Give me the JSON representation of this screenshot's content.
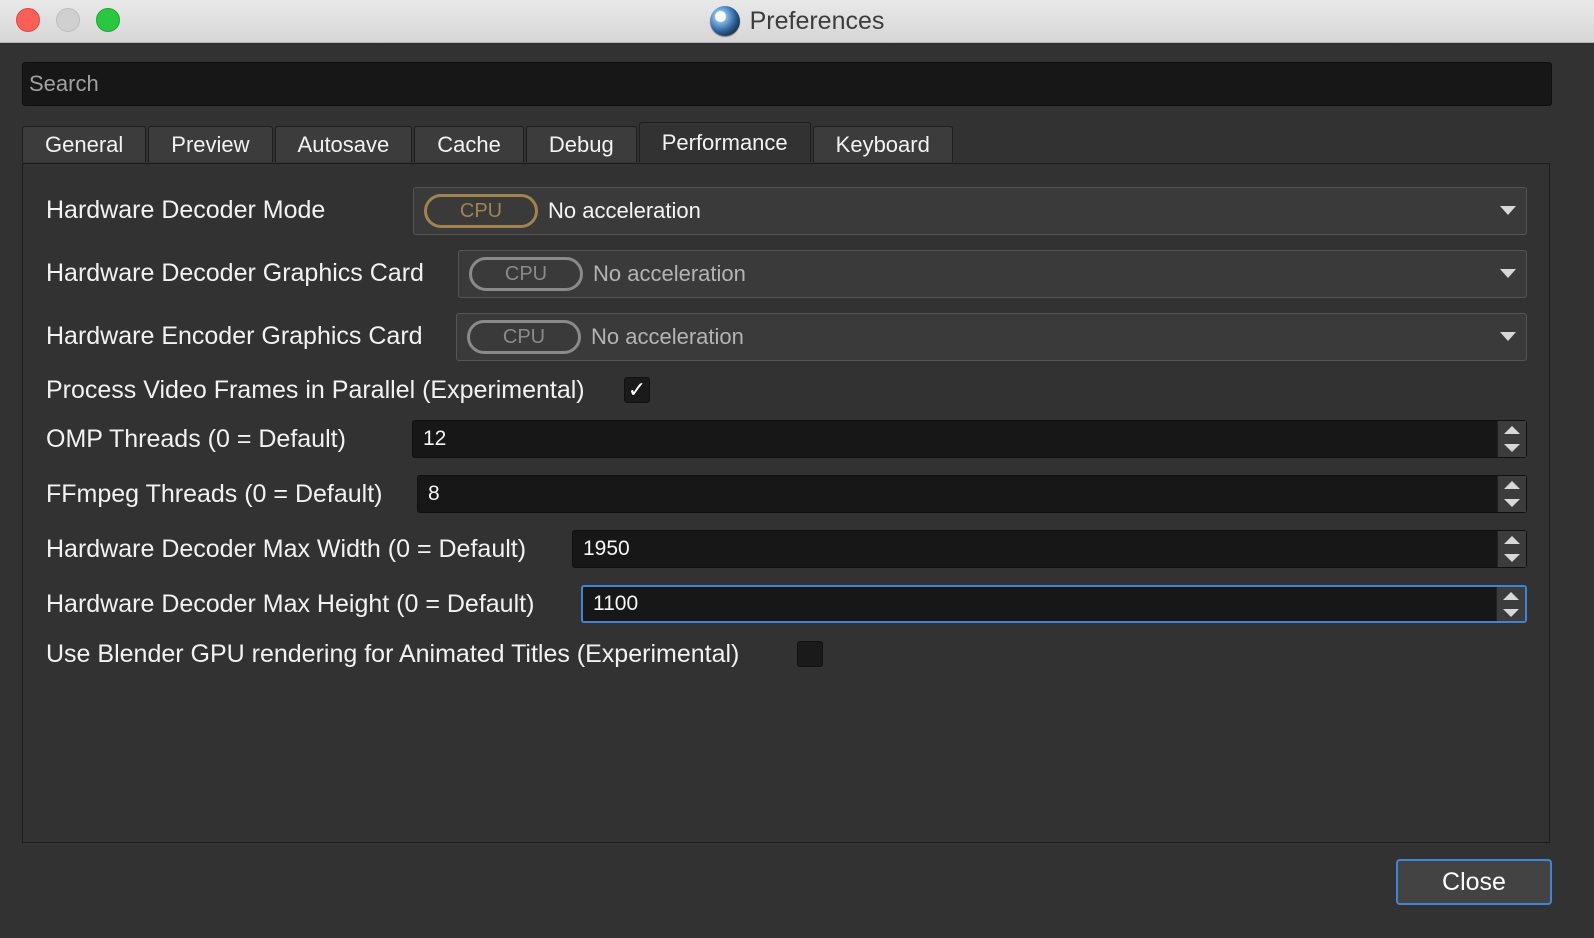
{
  "window": {
    "title": "Preferences",
    "app_icon": "openshot-logo-icon"
  },
  "search": {
    "placeholder": "Search"
  },
  "tabs": [
    {
      "label": "General",
      "active": false
    },
    {
      "label": "Preview",
      "active": false
    },
    {
      "label": "Autosave",
      "active": false
    },
    {
      "label": "Cache",
      "active": false
    },
    {
      "label": "Debug",
      "active": false
    },
    {
      "label": "Performance",
      "active": true
    },
    {
      "label": "Keyboard",
      "active": false
    }
  ],
  "settings": {
    "decoder_mode": {
      "label": "Hardware Decoder Mode",
      "badge": "CPU",
      "value": "No acceleration"
    },
    "decoder_card": {
      "label": "Hardware Decoder Graphics Card",
      "badge": "CPU",
      "value": "No acceleration"
    },
    "encoder_card": {
      "label": "Hardware Encoder Graphics Card",
      "badge": "CPU",
      "value": "No acceleration"
    },
    "parallel": {
      "label": "Process Video Frames in Parallel (Experimental)",
      "checked": true,
      "check_glyph": "✓"
    },
    "omp_threads": {
      "label": "OMP Threads (0 = Default)",
      "value": "12"
    },
    "ffmpeg_threads": {
      "label": "FFmpeg Threads (0 = Default)",
      "value": "8"
    },
    "max_width": {
      "label": "Hardware Decoder Max Width (0 = Default)",
      "value": "1950"
    },
    "max_height": {
      "label": "Hardware Decoder Max Height (0 = Default)",
      "value": "1100"
    },
    "blender_gpu": {
      "label": "Use Blender GPU rendering for Animated Titles (Experimental)",
      "checked": false
    }
  },
  "footer": {
    "close_label": "Close"
  },
  "colors": {
    "accent": "#3d86d6",
    "badge_active": "#a08450",
    "badge_inactive": "#8a8a8a"
  }
}
